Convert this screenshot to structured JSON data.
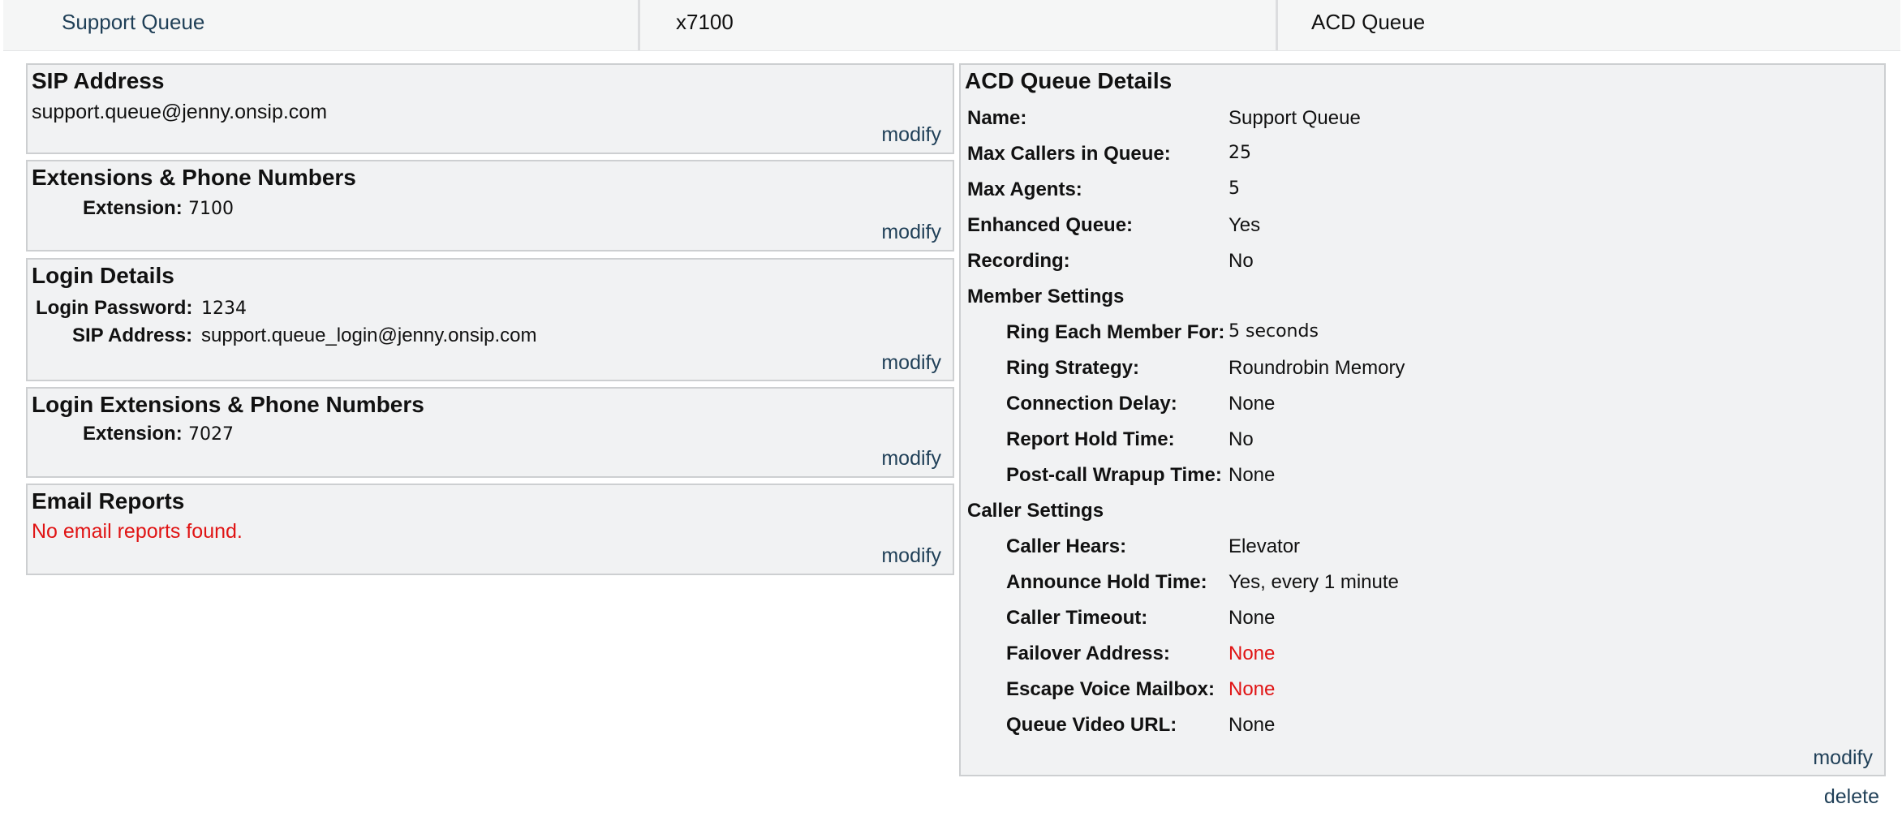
{
  "header": {
    "name": "Support Queue",
    "extension": "x7100",
    "type": "ACD Queue"
  },
  "sip_address": {
    "title": "SIP Address",
    "value": "support.queue@jenny.onsip.com",
    "modify": "modify"
  },
  "extensions": {
    "title": "Extensions & Phone Numbers",
    "extension_label": "Extension:",
    "extension_value": "7100",
    "modify": "modify"
  },
  "login_details": {
    "title": "Login Details",
    "password_label": "Login Password:",
    "password_value": "1234",
    "sip_label": "SIP Address:",
    "sip_value": "support.queue_login@jenny.onsip.com",
    "modify": "modify"
  },
  "login_extensions": {
    "title": "Login Extensions & Phone Numbers",
    "extension_label": "Extension:",
    "extension_value": "7027",
    "modify": "modify"
  },
  "email_reports": {
    "title": "Email Reports",
    "empty_message": "No email reports found.",
    "modify": "modify",
    "error_color": "#e01414"
  },
  "acd_details": {
    "title": "ACD Queue Details",
    "name_label": "Name:",
    "name_value": "Support Queue",
    "max_callers_label": "Max Callers in Queue:",
    "max_callers_value": "25",
    "max_agents_label": "Max Agents:",
    "max_agents_value": "5",
    "enhanced_label": "Enhanced Queue:",
    "enhanced_value": "Yes",
    "recording_label": "Recording:",
    "recording_value": "No",
    "member_settings": "Member Settings",
    "ring_each_label": "Ring Each Member For:",
    "ring_each_value": "5 seconds",
    "ring_strategy_label": "Ring Strategy:",
    "ring_strategy_value": "Roundrobin Memory",
    "connection_delay_label": "Connection Delay:",
    "connection_delay_value": "None",
    "report_hold_label": "Report Hold Time:",
    "report_hold_value": "No",
    "wrapup_label": "Post-call Wrapup Time:",
    "wrapup_value": "None",
    "caller_settings": "Caller Settings",
    "caller_hears_label": "Caller Hears:",
    "caller_hears_value": "Elevator",
    "announce_label": "Announce Hold Time:",
    "announce_value": "Yes, every 1 minute",
    "caller_timeout_label": "Caller Timeout:",
    "caller_timeout_value": "None",
    "failover_label": "Failover Address:",
    "failover_value": "None",
    "escape_label": "Escape Voice Mailbox:",
    "escape_value": "None",
    "video_label": "Queue Video URL:",
    "video_value": "None",
    "modify": "modify"
  },
  "delete_label": "delete",
  "colors": {
    "link": "#1f3f57",
    "panel_bg": "#f1f2f3",
    "panel_border": "#cdcfd1",
    "error": "#e01414"
  }
}
